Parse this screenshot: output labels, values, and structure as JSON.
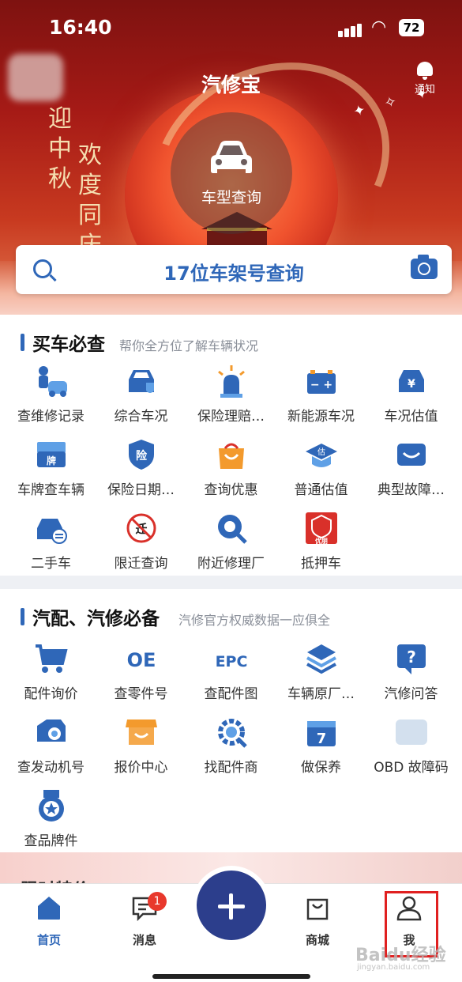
{
  "status_bar": {
    "time": "16:40",
    "battery": "72"
  },
  "header": {
    "title": "汽修宝",
    "notify_label": "通知"
  },
  "banner": {
    "poem_left": [
      "迎",
      "中",
      "秋"
    ],
    "poem_right": [
      "欢",
      "度",
      "同",
      "庆"
    ],
    "car_query_label": "车型查询"
  },
  "search": {
    "text": "17位车架号查询"
  },
  "section_buy": {
    "title": "买车必查",
    "subtitle": "帮你全方位了解车辆状况",
    "items": [
      {
        "label": "查维修记录",
        "icon": "mechanic-car-icon"
      },
      {
        "label": "综合车况",
        "icon": "car-shield-icon"
      },
      {
        "label": "保险理赔…",
        "icon": "alarm-light-icon"
      },
      {
        "label": "新能源车况",
        "icon": "battery-icon"
      },
      {
        "label": "车况估值",
        "icon": "car-yuan-icon"
      },
      {
        "label": "车牌查车辆",
        "icon": "license-plate-icon"
      },
      {
        "label": "保险日期…",
        "icon": "insurance-shield-icon"
      },
      {
        "label": "查询优惠",
        "icon": "shopping-bag-icon"
      },
      {
        "label": "普通估值",
        "icon": "graduation-cap-icon"
      },
      {
        "label": "典型故障…",
        "icon": "smile-box-icon"
      },
      {
        "label": "二手车",
        "icon": "used-car-icon"
      },
      {
        "label": "限迁查询",
        "icon": "no-transfer-icon"
      },
      {
        "label": "附近修理厂",
        "icon": "location-search-icon"
      },
      {
        "label": "抵押车",
        "icon": "youpeng-logo-icon"
      }
    ]
  },
  "section_parts": {
    "title": "汽配、汽修必备",
    "subtitle": "汽修官方权威数据一应俱全",
    "items": [
      {
        "label": "配件询价",
        "icon": "cart-icon"
      },
      {
        "label": "查零件号",
        "icon": "oe-icon"
      },
      {
        "label": "查配件图",
        "icon": "epc-icon"
      },
      {
        "label": "车辆原厂…",
        "icon": "layers-icon"
      },
      {
        "label": "汽修问答",
        "icon": "question-icon"
      },
      {
        "label": "查发动机号",
        "icon": "engine-icon"
      },
      {
        "label": "报价中心",
        "icon": "store-icon"
      },
      {
        "label": "找配件商",
        "icon": "gear-search-icon"
      },
      {
        "label": "做保养",
        "icon": "calendar-7-icon"
      },
      {
        "label": "OBD 故障码",
        "icon": "obd-icon"
      },
      {
        "label": "查品牌件",
        "icon": "medal-icon"
      }
    ]
  },
  "peek_title": "限时特价",
  "nav": {
    "home": "首页",
    "messages": "消息",
    "messages_badge": "1",
    "mall": "商城",
    "me": "我"
  },
  "watermark": {
    "main": "Baidu经验",
    "sub": "jingyan.baidu.com"
  },
  "colors": {
    "accent": "#2f67b8",
    "nav_plus": "#2c3e8c",
    "badge": "#e8382c",
    "highlight": "#e02020"
  }
}
